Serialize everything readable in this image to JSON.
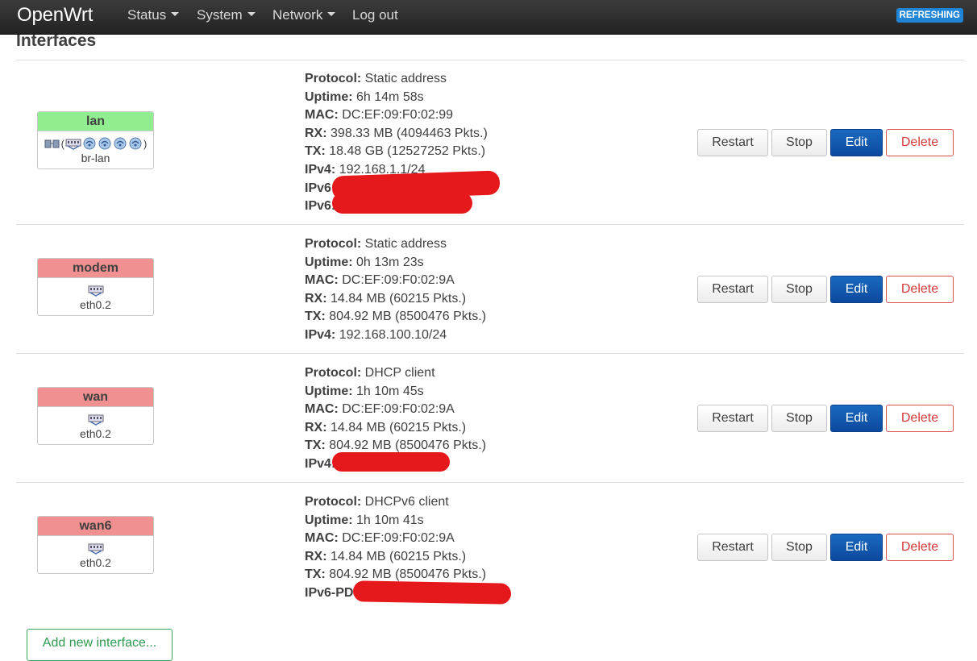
{
  "navbar": {
    "brand": "OpenWrt",
    "menu": [
      {
        "label": "Status",
        "has_caret": true
      },
      {
        "label": "System",
        "has_caret": true
      },
      {
        "label": "Network",
        "has_caret": true
      },
      {
        "label": "Log out",
        "has_caret": false
      }
    ],
    "refresh_badge": "REFRESHING",
    "refresh_badge_color": "#1f84d6"
  },
  "page": {
    "title": "Interfaces",
    "add_button": "Add new interface..."
  },
  "colors": {
    "lan_header": "#90ee90",
    "down_header": "#f09090",
    "edit_button": "#0b56ad",
    "delete_border": "#d9534f",
    "add_button_border": "#3aa55d",
    "redaction": "#e5191c"
  },
  "labels": {
    "protocol": "Protocol:",
    "uptime": "Uptime:",
    "mac": "MAC:",
    "rx": "RX:",
    "tx": "TX:",
    "ipv4": "IPv4:",
    "ipv6": "IPv6:",
    "ipv6pd": "IPv6-PD:"
  },
  "actions": {
    "restart": "Restart",
    "stop": "Stop",
    "edit": "Edit",
    "delete": "Delete"
  },
  "interfaces": [
    {
      "name": "lan",
      "device": "br-lan",
      "icons": [
        "bridge-icon",
        "ethernet-port-icon",
        "wifi-icon",
        "wifi-icon",
        "wifi-icon",
        "wifi-icon"
      ],
      "protocol": "Static address",
      "uptime": "6h 14m 58s",
      "mac": "DC:EF:09:F0:02:99",
      "rx": "398.33 MB (4094463 Pkts.)",
      "tx": "18.48 GB (12527252 Pkts.)",
      "ipv4": "192.168.1.1/24",
      "ipv6_redacted": true
    },
    {
      "name": "modem",
      "device": "eth0.2",
      "icons": [
        "ethernet-port-icon"
      ],
      "protocol": "Static address",
      "uptime": "0h 13m 23s",
      "mac": "DC:EF:09:F0:02:9A",
      "rx": "14.84 MB (60215 Pkts.)",
      "tx": "804.92 MB (8500476 Pkts.)",
      "ipv4": "192.168.100.10/24"
    },
    {
      "name": "wan",
      "device": "eth0.2",
      "icons": [
        "ethernet-port-icon"
      ],
      "protocol": "DHCP client",
      "uptime": "1h 10m 45s",
      "mac": "DC:EF:09:F0:02:9A",
      "rx": "14.84 MB (60215 Pkts.)",
      "tx": "804.92 MB (8500476 Pkts.)",
      "ipv4_redacted": true
    },
    {
      "name": "wan6",
      "device": "eth0.2",
      "icons": [
        "ethernet-port-icon"
      ],
      "protocol": "DHCPv6 client",
      "uptime": "1h 10m 41s",
      "mac": "DC:EF:09:F0:02:9A",
      "rx": "14.84 MB (60215 Pkts.)",
      "tx": "804.92 MB (8500476 Pkts.)",
      "ipv6pd_redacted": true
    }
  ]
}
